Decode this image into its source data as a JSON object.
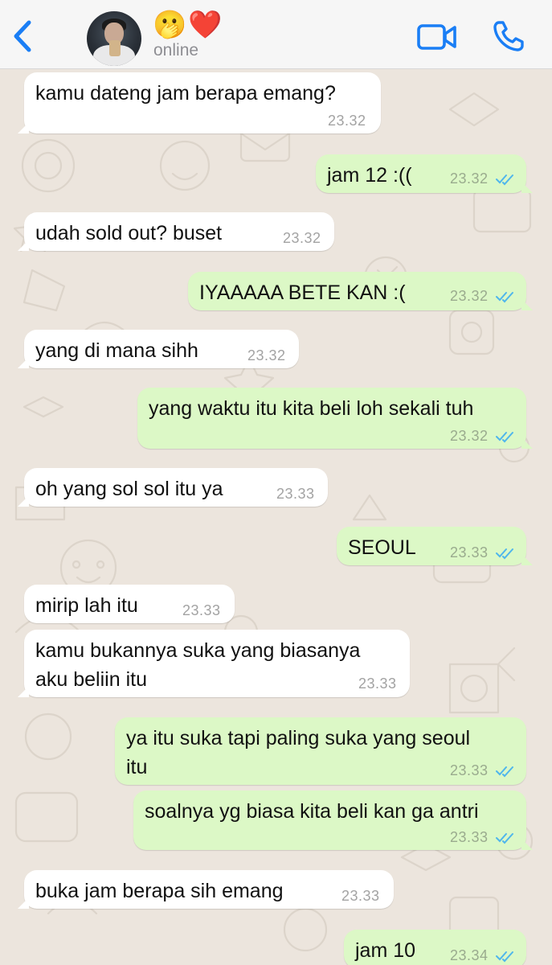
{
  "header": {
    "contact_emoji": "🫢❤️",
    "status": "online"
  },
  "messages": [
    {
      "dir": "in",
      "text": "kamu dateng jam berapa emang?",
      "time": "23.32"
    },
    {
      "dir": "out",
      "text": "jam 12 :((",
      "time": "23.32",
      "read": true
    },
    {
      "dir": "in",
      "text": "udah sold out? buset",
      "time": "23.32"
    },
    {
      "dir": "out",
      "text": "IYAAAAA BETE KAN :(",
      "time": "23.32",
      "read": true
    },
    {
      "dir": "in",
      "text": "yang di mana sihh",
      "time": "23.32"
    },
    {
      "dir": "out",
      "text": "yang waktu itu kita beli loh sekali tuh",
      "time": "23.32",
      "read": true
    },
    {
      "dir": "in",
      "text": "oh yang sol sol itu ya",
      "time": "23.33"
    },
    {
      "dir": "out",
      "text": "SEOUL",
      "time": "23.33",
      "read": true
    },
    {
      "dir": "in",
      "text": "mirip lah itu",
      "time": "23.33"
    },
    {
      "dir": "in",
      "text_lines": [
        "kamu bukannya suka yang biasanya",
        "aku beliin itu"
      ],
      "time": "23.33"
    },
    {
      "dir": "out",
      "text_lines": [
        "ya itu suka tapi paling suka yang seoul",
        "itu"
      ],
      "time": "23.33",
      "read": true
    },
    {
      "dir": "out",
      "text": "soalnya yg biasa kita beli kan ga antri",
      "time": "23.33",
      "read": true
    },
    {
      "dir": "in",
      "text": "buka jam berapa sih emang",
      "time": "23.33"
    },
    {
      "dir": "out",
      "text": "jam 10",
      "time": "23.34",
      "read": true
    }
  ],
  "colors": {
    "accent": "#1a7ef5",
    "incoming_bubble": "#ffffff",
    "outgoing_bubble": "#dcf8c6",
    "read_ticks": "#4fb6ec",
    "wallpaper": "#ece5dd"
  },
  "icons": [
    "back-chevron-icon",
    "video-call-icon",
    "phone-call-icon",
    "double-check-icon"
  ]
}
